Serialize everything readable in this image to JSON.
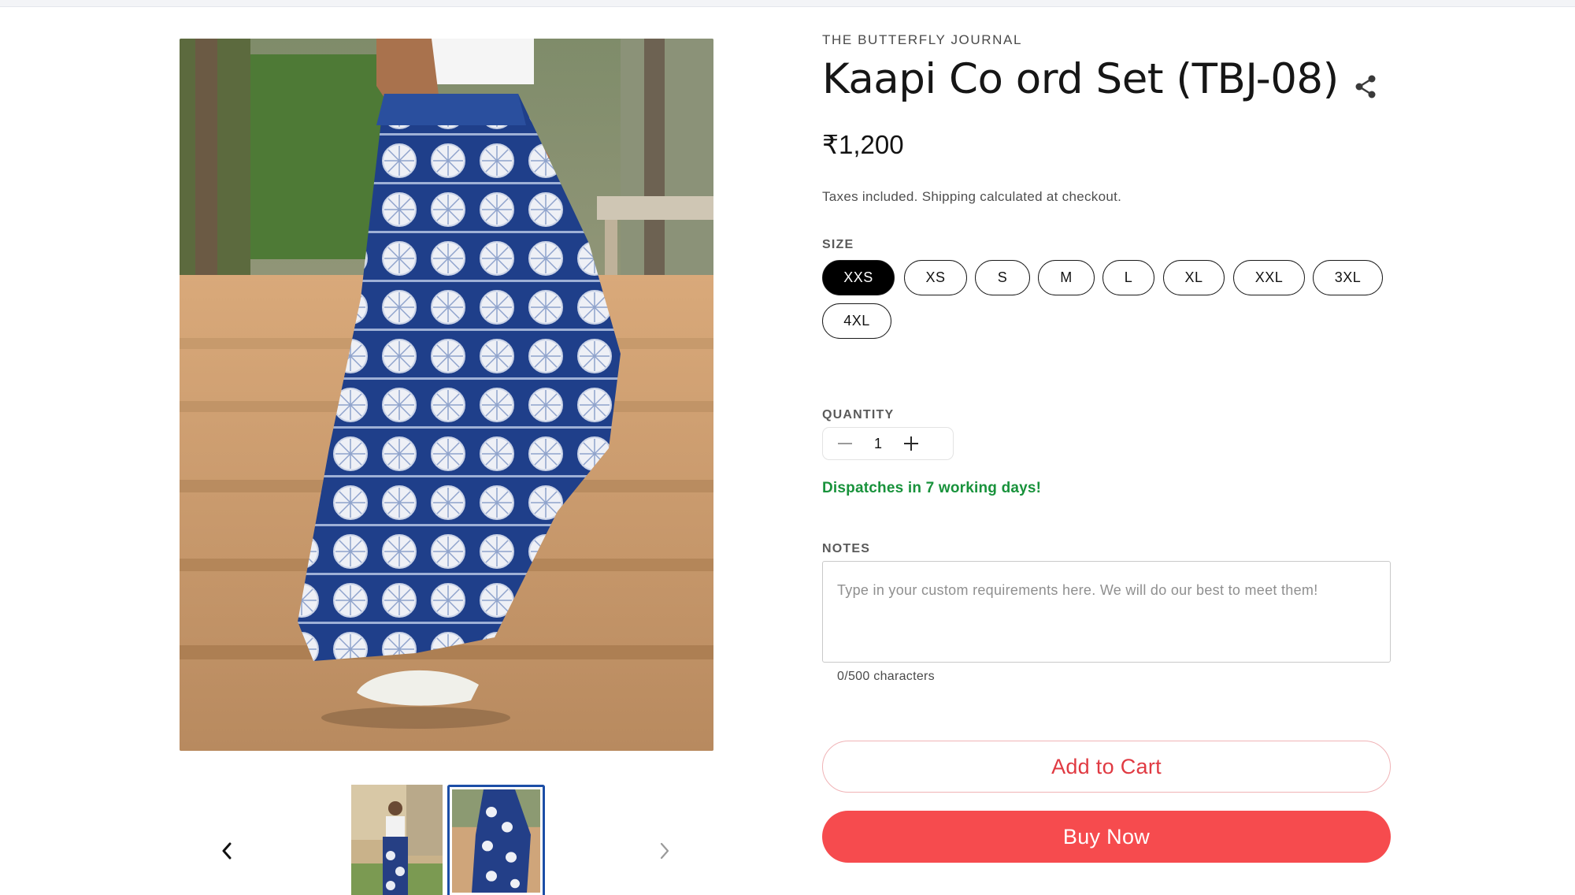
{
  "product": {
    "vendor": "THE BUTTERFLY JOURNAL",
    "title": "Kaapi Co ord Set (TBJ-08)",
    "price": "₹1,200",
    "tax_note": "Taxes included. Shipping calculated at checkout.",
    "share_icon": "share-icon"
  },
  "size": {
    "label": "SIZE",
    "options": [
      "XXS",
      "XS",
      "S",
      "M",
      "L",
      "XL",
      "XXL",
      "3XL",
      "4XL"
    ],
    "selected": "XXS"
  },
  "quantity": {
    "label": "QUANTITY",
    "value": "1",
    "decrease_icon": "minus-icon",
    "increase_icon": "plus-icon"
  },
  "dispatch_note": "Dispatches in 7 working days!",
  "notes": {
    "label": "NOTES",
    "placeholder": "Type in your custom requirements here. We will do our best to meet them!",
    "char_count": "0/500 characters"
  },
  "actions": {
    "add_to_cart": "Add to Cart",
    "buy_now": "Buy Now"
  },
  "gallery": {
    "main_image": "model in blue white tie-dye skirt on stone steps",
    "thumbnails": [
      "model full view",
      "skirt close view"
    ],
    "selected_thumbnail": 1,
    "prev_icon": "chevron-left-icon",
    "next_icon": "chevron-right-icon"
  },
  "colors": {
    "accent_red": "#f64b4e",
    "dispatch_green": "#18923b",
    "thumb_border": "#1c4ea6"
  }
}
